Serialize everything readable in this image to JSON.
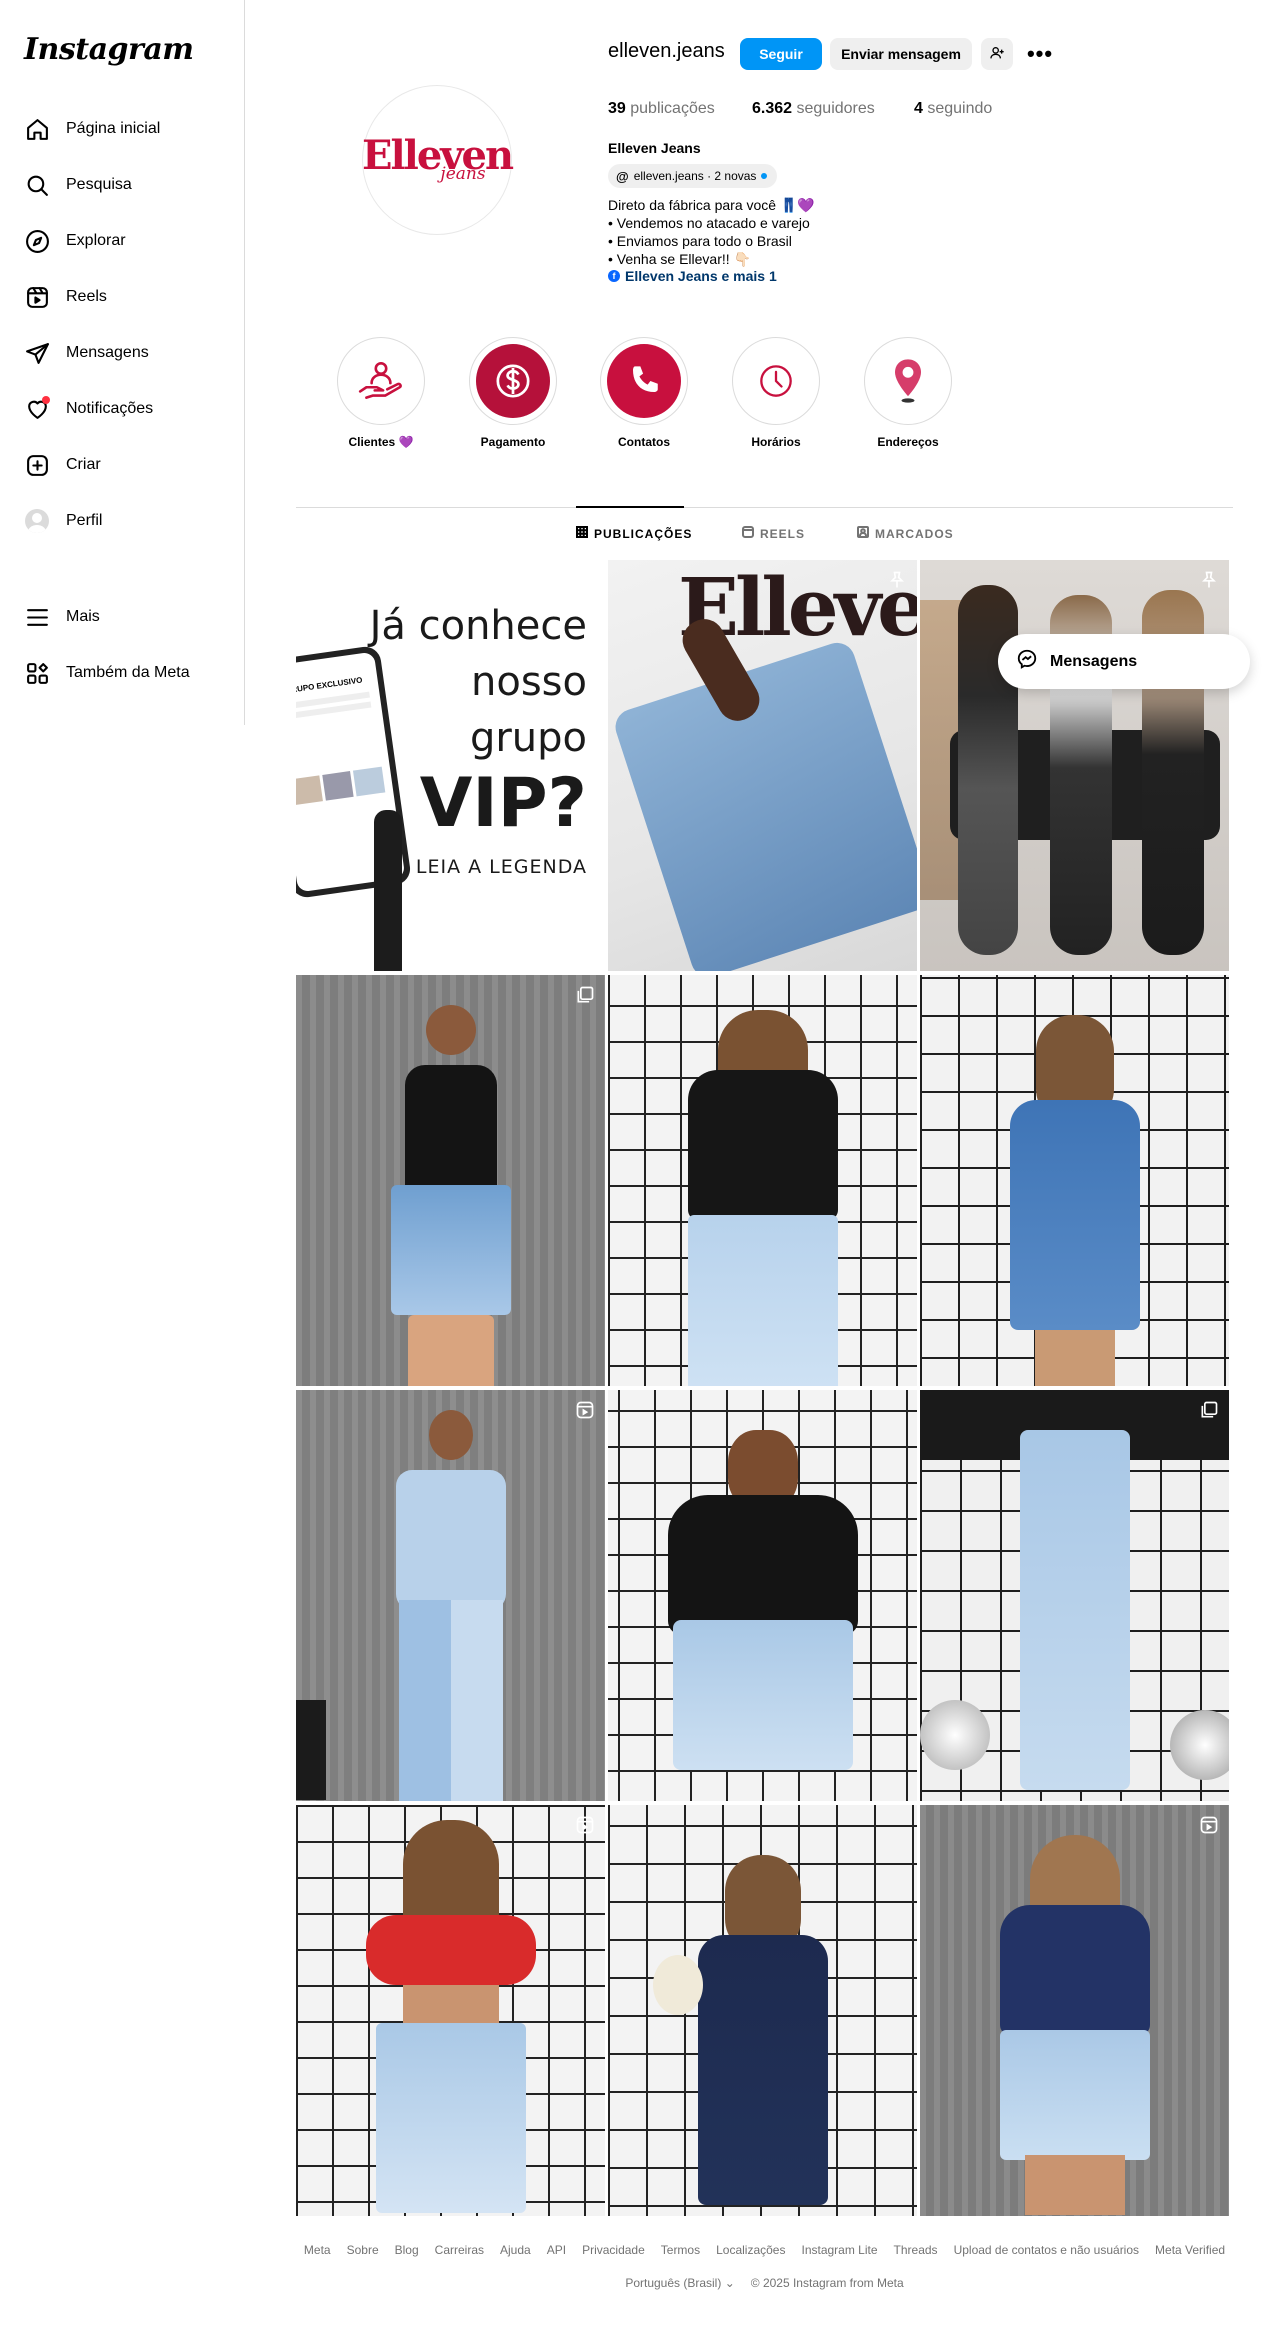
{
  "app": {
    "logo": "Instagram"
  },
  "sidebar": {
    "items": [
      {
        "label": "Página inicial",
        "icon": "home-icon"
      },
      {
        "label": "Pesquisa",
        "icon": "search-icon"
      },
      {
        "label": "Explorar",
        "icon": "compass-icon"
      },
      {
        "label": "Reels",
        "icon": "reels-icon"
      },
      {
        "label": "Mensagens",
        "icon": "send-icon"
      },
      {
        "label": "Notificações",
        "icon": "heart-icon"
      },
      {
        "label": "Criar",
        "icon": "plus-square-icon"
      },
      {
        "label": "Perfil",
        "icon": "avatar"
      },
      {
        "label": "Mais",
        "icon": "menu-icon"
      },
      {
        "label": "Também da Meta",
        "icon": "meta-apps-icon"
      }
    ]
  },
  "profile": {
    "username": "elleven.jeans",
    "logo_main": "Elleven",
    "logo_sub": "jeans",
    "follow_label": "Seguir",
    "message_label": "Enviar mensagem",
    "more_label": "•••",
    "stats": {
      "posts_value": "39",
      "posts_label": "publicações",
      "followers_value": "6.362",
      "followers_label": "seguidores",
      "following_value": "4",
      "following_label": "seguindo"
    },
    "full_name": "Elleven Jeans",
    "threads_badge": "elleven.jeans · 2 novas",
    "bio_lines": [
      "Direto da fábrica para você 👖💜",
      "• Vendemos no atacado e varejo",
      "• Enviamos para todo o Brasil",
      "• Venha se Ellevar!! 👇🏻"
    ],
    "link_text": "Elleven Jeans e mais 1"
  },
  "highlights": [
    {
      "label": "Clientes 💜",
      "icon": "hand-user-icon"
    },
    {
      "label": "Pagamento",
      "icon": "dollar-icon"
    },
    {
      "label": "Contatos",
      "icon": "phone-icon"
    },
    {
      "label": "Horários",
      "icon": "clock-icon"
    },
    {
      "label": "Endereços",
      "icon": "location-pin-icon"
    }
  ],
  "tabs": [
    {
      "label": "PUBLICAÇÕES",
      "active": true
    },
    {
      "label": "REELS",
      "active": false
    },
    {
      "label": "MARCADOS",
      "active": false
    }
  ],
  "vip_post": {
    "line1": "Já conhece",
    "line2": "nosso",
    "line3": "grupo",
    "line4": "VIP?",
    "line5": "LEIA A LEGENDA",
    "phone_title": "GRUPO EXCLUSIVO"
  },
  "post2_brand": "Elleven",
  "floating": {
    "messages_label": "Mensagens"
  },
  "footer": {
    "links": [
      "Meta",
      "Sobre",
      "Blog",
      "Carreiras",
      "Ajuda",
      "API",
      "Privacidade",
      "Termos",
      "Localizações",
      "Instagram Lite",
      "Threads",
      "Upload de contatos e não usuários",
      "Meta Verified"
    ],
    "language": "Português (Brasil)",
    "copyright": "© 2025 Instagram from Meta"
  },
  "colors": {
    "accent": "#0095f6",
    "brand": "#c8103e",
    "link": "#00376b"
  }
}
